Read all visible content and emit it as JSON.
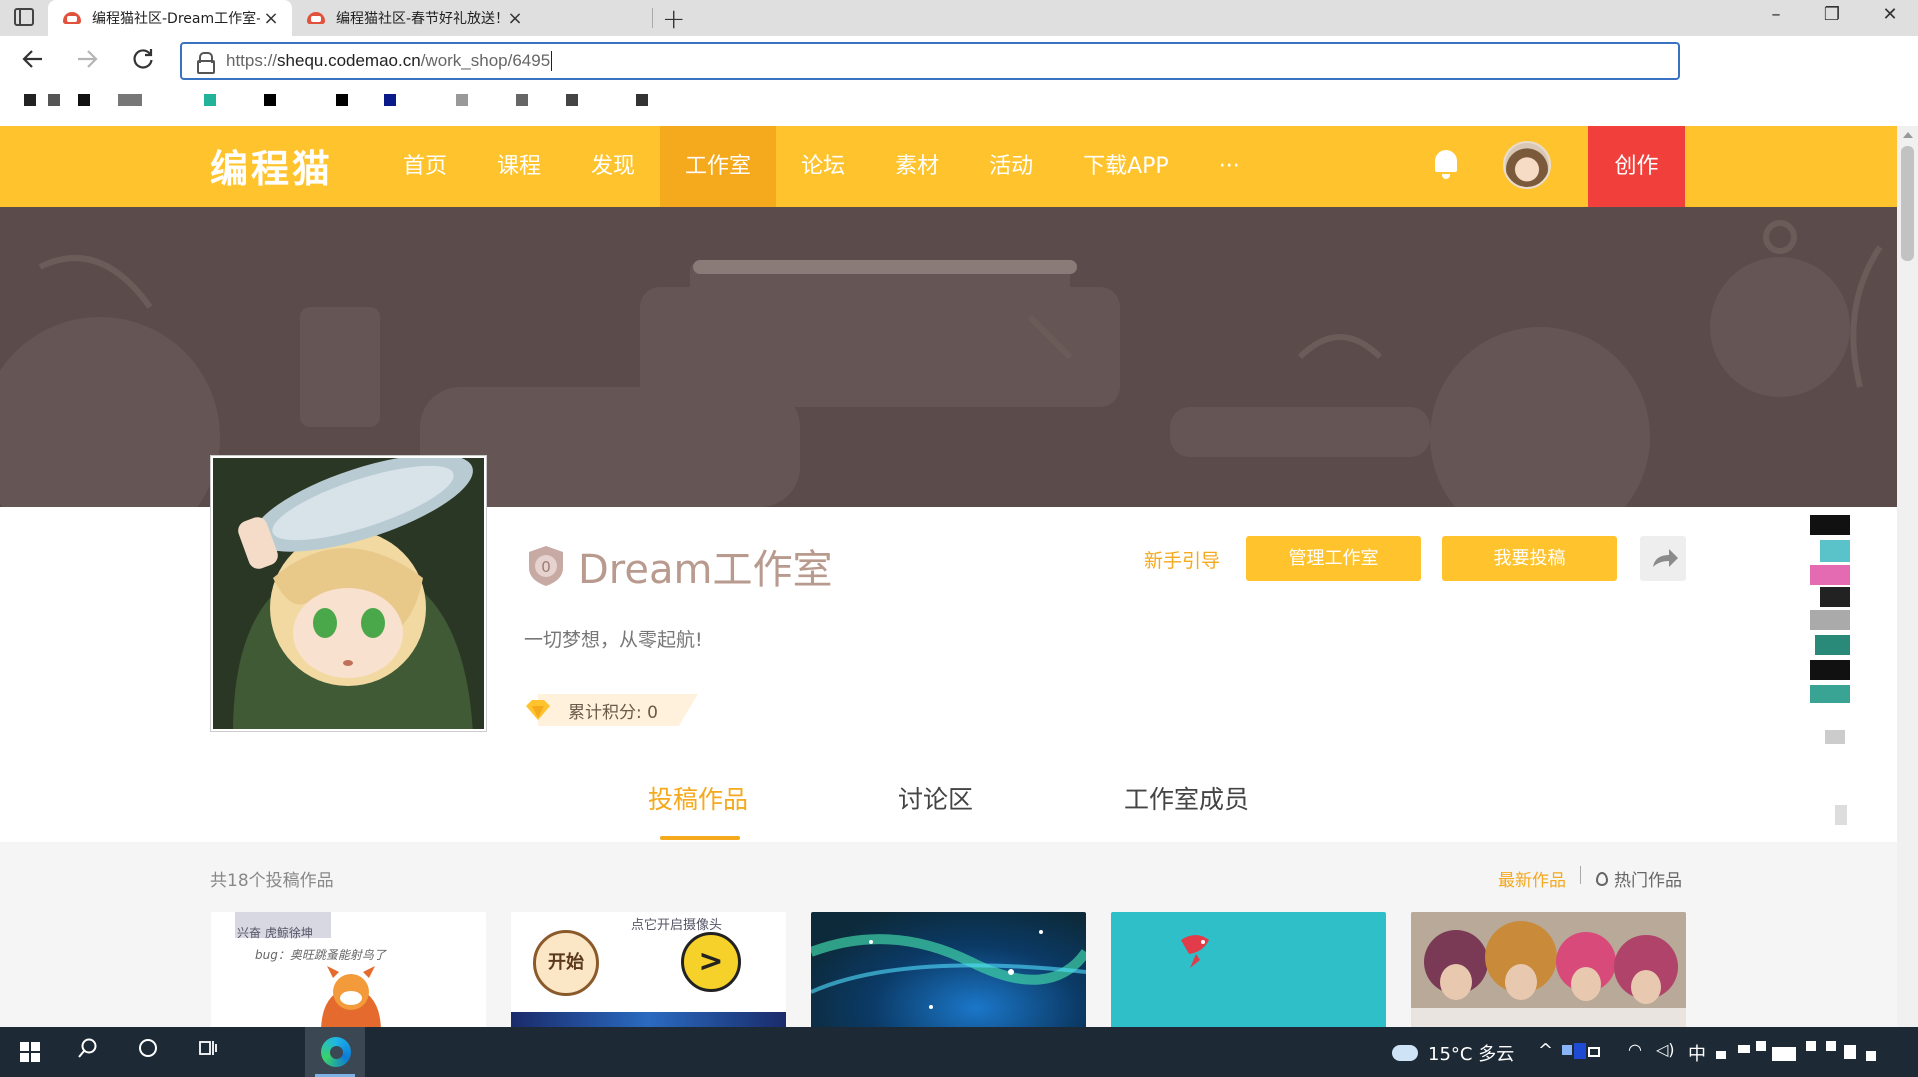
{
  "browser": {
    "tabs": [
      {
        "title": "编程猫社区-Dream工作室-一起学",
        "active": true
      },
      {
        "title": "编程猫社区-春节好礼放送！加入",
        "active": false
      }
    ],
    "address": {
      "prefix": "https://",
      "host": "shequ.codemao.cn",
      "path": "/work_shop/6495"
    },
    "icons": {
      "back": "arrow-left-icon",
      "forward": "arrow-right-icon",
      "reload": "reload-icon",
      "new_tab": "+",
      "close": "×",
      "minimize": "–",
      "maximize": "❐",
      "win_close": "✕"
    }
  },
  "site": {
    "logo": "编程猫",
    "nav": [
      {
        "label": "首页",
        "active": false
      },
      {
        "label": "课程",
        "active": false
      },
      {
        "label": "发现",
        "active": false
      },
      {
        "label": "工作室",
        "active": true
      },
      {
        "label": "论坛",
        "active": false
      },
      {
        "label": "素材",
        "active": false
      },
      {
        "label": "活动",
        "active": false
      },
      {
        "label": "下载APP",
        "active": false
      },
      {
        "label": "···",
        "active": false
      }
    ],
    "create_label": "创作",
    "colors": {
      "brand": "#ffc32d",
      "active_nav": "#f5a91c",
      "create": "#f1403c",
      "banner": "#5b4c4b"
    }
  },
  "studio": {
    "level": "0",
    "name": "Dream工作室",
    "guide_link": "新手引导",
    "manage_button": "管理工作室",
    "submit_button": "我要投稿",
    "motto": "一切梦想，从零起航!",
    "points_label": "累计积分: 0"
  },
  "tabs": [
    {
      "label": "投稿作品",
      "active": true
    },
    {
      "label": "讨论区",
      "active": false
    },
    {
      "label": "工作室成员",
      "active": false
    }
  ],
  "works": {
    "count_text": "共18个投稿作品",
    "sort_latest": "最新作品",
    "sort_hot": "热门作品",
    "cards": [
      {
        "name": "work-card-1",
        "caption": "兴奋 虎鲸徐坤",
        "subcaption": "bug：奥旺跳蚤能射鸟了"
      },
      {
        "name": "work-card-2",
        "caption": "点它开启摄像头",
        "start_label": "开始",
        "arrow": ">"
      },
      {
        "name": "work-card-3"
      },
      {
        "name": "work-card-4"
      },
      {
        "name": "work-card-5"
      }
    ]
  },
  "taskbar": {
    "weather": "15°C 多云",
    "ime": "中"
  }
}
